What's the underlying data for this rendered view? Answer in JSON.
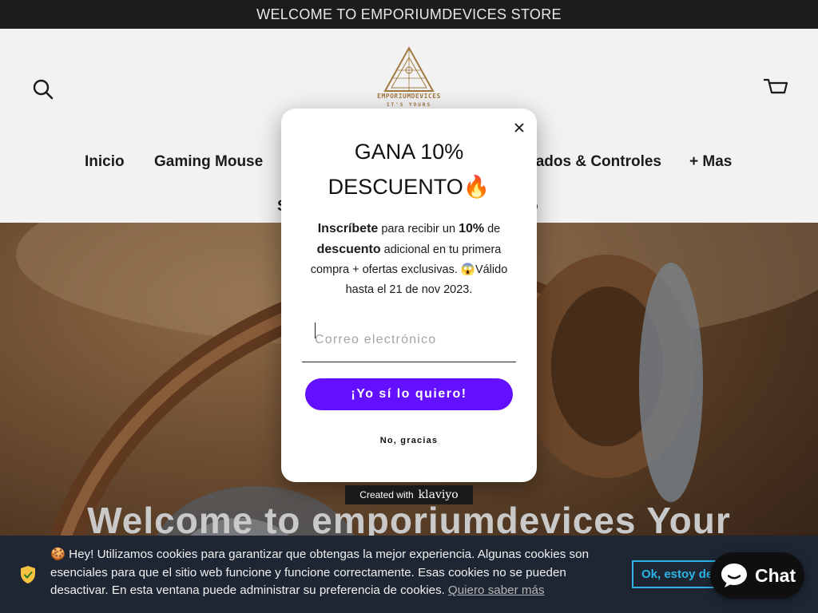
{
  "announcement": "WELCOME TO EMPORIUMDEVICES STORE",
  "header": {
    "logo_text": "EMPORIUMDEVICES",
    "logo_sub": "IT'S YOURS",
    "nav_row1": [
      "Inicio",
      "Gaming Mouse",
      "Teclados & Controles",
      "+ Mas"
    ],
    "nav_row2_partial": [
      "S",
      "o"
    ]
  },
  "hero": {
    "title": "Welcome to emporiumdevices Your"
  },
  "popup": {
    "title_line1": "GANA 10%",
    "title_line2": "DESCUENTO🔥",
    "body_b1": "Inscríbete",
    "body_t1": " para recibir un ",
    "body_b2": "10%",
    "body_t2": " de ",
    "body_b3": "descuento",
    "body_t3": " adicional en tu primera compra + ofertas exclusivas. 😱Válido hasta el 21 de nov 2023.",
    "email_placeholder": "Correo electrónico",
    "email_value": "",
    "cta_label": "¡Yo sí lo quiero!",
    "decline_label": "No, gracias",
    "branding_prefix": "Created with",
    "branding_logo": "klaviyo"
  },
  "cookie_bar": {
    "text": "🍪 Hey! Utilizamos cookies para garantizar que obtengas la mejor experiencia. Algunas cookies son esenciales para que el sitio web funcione y funcione correctamente. Esas cookies no se pueden desactivar. En esta ventana puede administrar su preferencia de cookies.",
    "link": "Quiero saber más",
    "ok_label": "Ok, estoy de acuerdo"
  },
  "chat": {
    "label": "Chat"
  },
  "colors": {
    "announcement_bg": "#1c1c1c",
    "header_bg": "#f2f2f2",
    "cta": "#6210ff",
    "cookie_bg": "#1e2634",
    "cookie_accent": "#2cb4e6",
    "chat_bg": "#0f0f0f"
  },
  "icons": {
    "search": "search-icon",
    "cart": "cart-icon",
    "close": "close-icon",
    "shield": "shield-check-icon",
    "chat": "chat-bubble-icon"
  }
}
